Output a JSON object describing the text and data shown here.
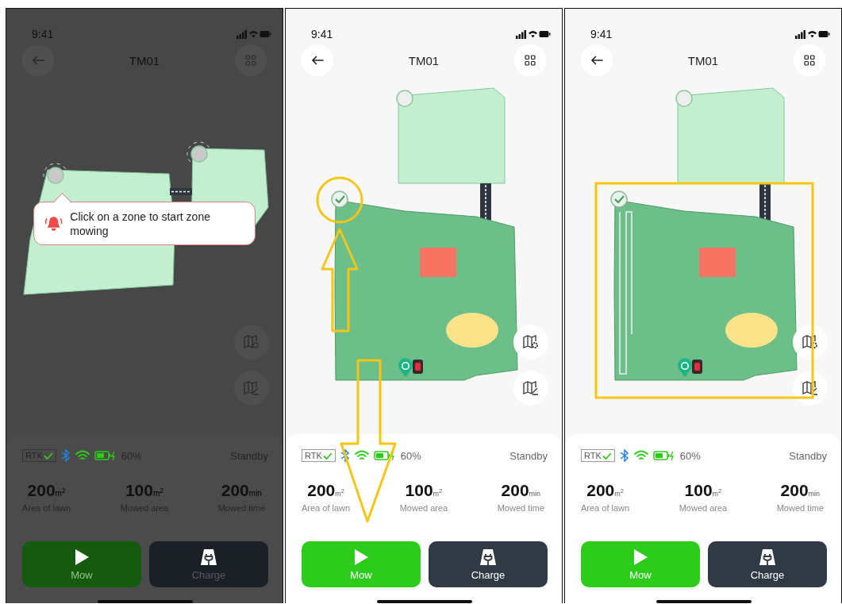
{
  "panels": [
    {
      "dimmed": true,
      "time": "9:41",
      "title": "TM01",
      "map": {
        "kind": "zone_select"
      },
      "tooltip": "Click on a zone to start zone mowing",
      "annotation": {
        "kind": "none"
      },
      "status": {
        "rtk": "RTK",
        "battery": "60%",
        "state": "Standby"
      },
      "stats": [
        {
          "value": "200",
          "unit": "m$^{2}$",
          "label": "Area of lawn"
        },
        {
          "value": "100",
          "unit": "m$^{2}$",
          "label": "Mowed area"
        },
        {
          "value": "200",
          "unit": "min",
          "label": "Mowed time"
        }
      ],
      "buttons": [
        {
          "kind": "mow",
          "label": "Mow"
        },
        {
          "kind": "charge",
          "label": "Charge"
        }
      ]
    },
    {
      "dimmed": false,
      "time": "9:41",
      "title": "TM01",
      "map": {
        "kind": "zone_selected"
      },
      "annotation": {
        "kind": "circle_arrows"
      },
      "status": {
        "rtk": "RTK",
        "battery": "60%",
        "state": "Standby"
      },
      "stats": [
        {
          "value": "200",
          "unit": "m$^{2}$",
          "label": "Area of lawn"
        },
        {
          "value": "100",
          "unit": "m$^{2}$",
          "label": "Mowed area"
        },
        {
          "value": "200",
          "unit": "min",
          "label": "Mowed time"
        }
      ],
      "buttons": [
        {
          "kind": "mow",
          "label": "Mow"
        },
        {
          "kind": "charge",
          "label": "Charge"
        }
      ]
    },
    {
      "dimmed": false,
      "time": "9:41",
      "title": "TM01",
      "map": {
        "kind": "zone_mowing"
      },
      "annotation": {
        "kind": "frame"
      },
      "status": {
        "rtk": "RTK",
        "battery": "60%",
        "state": "Standby"
      },
      "stats": [
        {
          "value": "200",
          "unit": "m$^{2}$",
          "label": "Area of lawn"
        },
        {
          "value": "100",
          "unit": "m$^{2}$",
          "label": "Mowed area"
        },
        {
          "value": "200",
          "unit": "min",
          "label": "Mowed time"
        }
      ],
      "buttons": [
        {
          "kind": "mow",
          "label": "Mow"
        },
        {
          "kind": "charge",
          "label": "Charge"
        }
      ]
    }
  ]
}
